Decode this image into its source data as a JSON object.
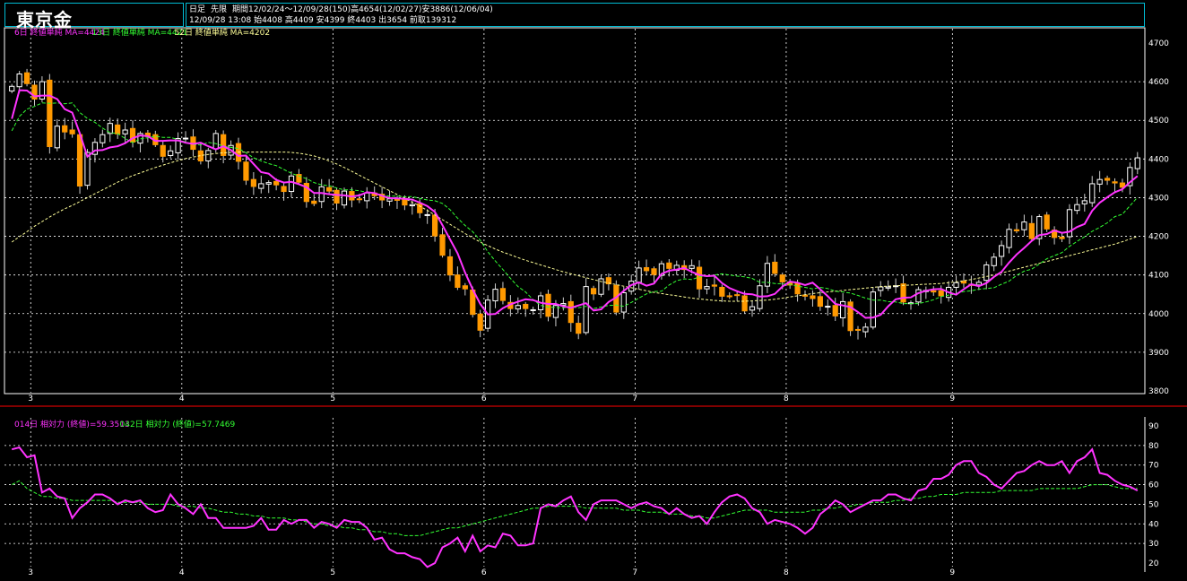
{
  "title": "東京金",
  "header": {
    "line1": {
      "chart_type": "日足",
      "contract": "先限",
      "period": "期間12/02/24～12/09/28(150)",
      "high": "高4654(12/02/27)",
      "low": "安3886(12/06/04)"
    },
    "line2": "12/09/28 13:08 始4408 高4409 安4399 終4403 出3654 前取139312"
  },
  "upper_legend": [
    {
      "text": "6日 終値単純 MA=4424",
      "color": "#ff33ff"
    },
    {
      "text": "13日 終値単純 MA=4421",
      "color": "#33ff33"
    },
    {
      "text": "52日 終値単純 MA=4202",
      "color": "#ffff99"
    }
  ],
  "lower_legend": [
    {
      "text": "014日 相対力 (終値)=59.3513",
      "color": "#ff33ff"
    },
    {
      "text": "042日 相対力 (終値)=57.7469",
      "color": "#33ff33"
    }
  ],
  "colors": {
    "up": "#ffffff",
    "down": "#ff9900",
    "ma6": "#ff33ff",
    "ma13": "#33ff33",
    "ma52": "#ffff99",
    "rsi14": "#ff33ff",
    "rsi42": "#33ff33",
    "frame": "#00bcd4",
    "separator": "#ff0000"
  },
  "chart_data": [
    {
      "type": "candlestick",
      "ylim": [
        3800,
        4700
      ],
      "y_ticks": [
        "4700",
        "4600",
        "4500",
        "4400",
        "4300",
        "4200",
        "4100",
        "4000",
        "3900",
        "3800"
      ],
      "x_month_labels": [
        "3",
        "4",
        "5",
        "6",
        "7",
        "8",
        "9"
      ],
      "x_month_positions": [
        2.5,
        22.5,
        42.5,
        62.5,
        82.5,
        102.5,
        124.5
      ],
      "n": 150,
      "closes": [
        4588,
        4620,
        4595,
        4555,
        4600,
        4432,
        4485,
        4470,
        4465,
        4330,
        4417,
        4443,
        4463,
        4492,
        4465,
        4475,
        4444,
        4466,
        4458,
        4437,
        4407,
        4421,
        4453,
        4454,
        4425,
        4395,
        4422,
        4466,
        4409,
        4435,
        4394,
        4345,
        4329,
        4336,
        4339,
        4333,
        4316,
        4356,
        4340,
        4290,
        4285,
        4328,
        4317,
        4286,
        4317,
        4294,
        4296,
        4312,
        4305,
        4294,
        4297,
        4293,
        4281,
        4282,
        4261,
        4256,
        4201,
        4151,
        4100,
        4068,
        4064,
        3998,
        3957,
        4035,
        4063,
        4034,
        4013,
        4021,
        4013,
        4010,
        4046,
        3993,
        4021,
        4026,
        3977,
        3949,
        4070,
        4051,
        4090,
        4077,
        4004,
        4054,
        4084,
        4118,
        4111,
        4101,
        4129,
        4117,
        4125,
        4114,
        4124,
        4064,
        4070,
        4071,
        4045,
        4044,
        4048,
        4007,
        4018,
        4072,
        4130,
        4104,
        4082,
        4074,
        4051,
        4045,
        4039,
        4019,
        4019,
        3994,
        4031,
        3956,
        3957,
        3965,
        4056,
        4069,
        4069,
        4072,
        4030,
        4028,
        4062,
        4060,
        4056,
        4046,
        4068,
        4080,
        4079,
        4073,
        4081,
        4126,
        4146,
        4176,
        4218,
        4214,
        4237,
        4194,
        4251,
        4219,
        4197,
        4194,
        4269,
        4282,
        4292,
        4336,
        4347,
        4345,
        4338,
        4327,
        4378,
        4403
      ],
      "ma6": [
        4504,
        4578,
        4577,
        4562,
        4564,
        4564,
        4555,
        4529,
        4520,
        4466,
        4406,
        4422,
        4423,
        4430,
        4433,
        4441,
        4454,
        4461,
        4459,
        4447,
        4447,
        4448,
        4448,
        4442,
        4439,
        4442,
        4433,
        4425,
        4433,
        4423,
        4408,
        4409,
        4387,
        4366,
        4362,
        4346,
        4339,
        4341,
        4335,
        4327,
        4312,
        4312,
        4309,
        4307,
        4306,
        4303,
        4306,
        4314,
        4312,
        4305,
        4299,
        4298,
        4297,
        4295,
        4287,
        4278,
        4263,
        4229,
        4192,
        4156,
        4106,
        4063,
        4025,
        3998,
        3999,
        4014,
        4024,
        4031,
        4037,
        4035,
        4028,
        4025,
        4025,
        4019,
        4015,
        4021,
        4027,
        4008,
        4011,
        4030,
        4042,
        4059,
        4074,
        4081,
        4072,
        4078,
        4103,
        4111,
        4114,
        4118,
        4108,
        4100,
        4097,
        4098,
        4079,
        4066,
        4058,
        4051,
        4050,
        4044,
        4045,
        4051,
        4070,
        4083,
        4080,
        4074,
        4080,
        4063,
        4045,
        4025,
        4021,
        4017,
        4004,
        3989,
        3990,
        3997,
        4019,
        4037,
        4041,
        4042,
        4053,
        4059,
        4063,
        4064,
        4055,
        4049,
        4063,
        4076,
        4071,
        4079,
        4095,
        4108,
        4132,
        4153,
        4170,
        4188,
        4203,
        4206,
        4215,
        4209,
        4212,
        4224,
        4232,
        4266,
        4287,
        4301,
        4314,
        4322,
        4340,
        4356
      ],
      "ma13": [
        4473,
        4510,
        4529,
        4536,
        4545,
        4544,
        4545,
        4543,
        4545,
        4520,
        4505,
        4495,
        4480,
        4468,
        4466,
        4453,
        4442,
        4452,
        4455,
        4459,
        4456,
        4456,
        4450,
        4444,
        4438,
        4436,
        4443,
        4440,
        4433,
        4430,
        4427,
        4416,
        4403,
        4395,
        4388,
        4383,
        4373,
        4363,
        4356,
        4349,
        4339,
        4333,
        4331,
        4325,
        4320,
        4320,
        4318,
        4314,
        4312,
        4306,
        4304,
        4304,
        4302,
        4303,
        4298,
        4294,
        4292,
        4285,
        4269,
        4247,
        4228,
        4212,
        4190,
        4160,
        4136,
        4114,
        4091,
        4070,
        4056,
        4036,
        4021,
        4017,
        4016,
        4015,
        4017,
        4015,
        4019,
        4013,
        4017,
        4021,
        4022,
        4019,
        4029,
        4040,
        4051,
        4057,
        4058,
        4074,
        4085,
        4090,
        4088,
        4095,
        4097,
        4100,
        4103,
        4100,
        4097,
        4095,
        4091,
        4081,
        4081,
        4078,
        4077,
        4076,
        4071,
        4068,
        4064,
        4068,
        4065,
        4058,
        4056,
        4053,
        4047,
        4040,
        4035,
        4035,
        4031,
        4030,
        4026,
        4026,
        4026,
        4030,
        4036,
        4044,
        4048,
        4052,
        4057,
        4059,
        4063,
        4065,
        4067,
        4076,
        4084,
        4099,
        4110,
        4115,
        4128,
        4142,
        4150,
        4158,
        4174,
        4187,
        4199,
        4213,
        4223,
        4235,
        4251,
        4257,
        4279,
        4301
      ],
      "ma52": [
        4185,
        4199,
        4212,
        4226,
        4238,
        4250,
        4261,
        4271,
        4280,
        4290,
        4300,
        4310,
        4320,
        4330,
        4340,
        4349,
        4357,
        4364,
        4371,
        4378,
        4384,
        4390,
        4396,
        4401,
        4405,
        4409,
        4412,
        4414,
        4416,
        4417,
        4418,
        4418,
        4418,
        4418,
        4418,
        4418,
        4418,
        4417,
        4415,
        4412,
        4408,
        4402,
        4395,
        4387,
        4378,
        4368,
        4358,
        4348,
        4338,
        4328,
        4318,
        4308,
        4298,
        4288,
        4278,
        4267,
        4255,
        4243,
        4231,
        4219,
        4207,
        4196,
        4185,
        4176,
        4167,
        4159,
        4152,
        4145,
        4138,
        4132,
        4126,
        4120,
        4114,
        4108,
        4103,
        4098,
        4093,
        4088,
        4083,
        4079,
        4075,
        4071,
        4067,
        4063,
        4059,
        4055,
        4052,
        4049,
        4046,
        4043,
        4040,
        4038,
        4036,
        4034,
        4033,
        4032,
        4032,
        4032,
        4033,
        4034,
        4035,
        4037,
        4040,
        4043,
        4046,
        4049,
        4052,
        4054,
        4056,
        4058,
        4060,
        4062,
        4064,
        4066,
        4068,
        4070,
        4071,
        4072,
        4073,
        4074,
        4075,
        4076,
        4077,
        4078,
        4080,
        4082,
        4085,
        4088,
        4092,
        4096,
        4100,
        4105,
        4110,
        4115,
        4120,
        4125,
        4130,
        4135,
        4140,
        4145,
        4150,
        4155,
        4160,
        4165,
        4170,
        4175,
        4180,
        4186,
        4193,
        4200
      ]
    },
    {
      "type": "line",
      "ylim": [
        20,
        90
      ],
      "y_ticks": [
        "90",
        "80",
        "70",
        "60",
        "50",
        "40",
        "30",
        "20"
      ],
      "rsi14": [
        78,
        79,
        74,
        75,
        56,
        58,
        54,
        53,
        43,
        48,
        51,
        55,
        55,
        53,
        50,
        52,
        51,
        52,
        48,
        46,
        47,
        55,
        50,
        48,
        45,
        50,
        43,
        43,
        38,
        38,
        38,
        38,
        39,
        43,
        37,
        37,
        42,
        40,
        42,
        42,
        38,
        41,
        40,
        38,
        42,
        41,
        41,
        38,
        32,
        33,
        27,
        25,
        25,
        23,
        22,
        18,
        20,
        28,
        30,
        33,
        26,
        34,
        26,
        29,
        28,
        35,
        34,
        29,
        29,
        30,
        48,
        50,
        49,
        52,
        54,
        46,
        42,
        50,
        52,
        52,
        52,
        50,
        48,
        50,
        51,
        49,
        48,
        45,
        48,
        45,
        43,
        44,
        40,
        46,
        51,
        54,
        55,
        53,
        48,
        46,
        40,
        42,
        41,
        40,
        38,
        35,
        38,
        45,
        48,
        52,
        50,
        46,
        48,
        50,
        52,
        52,
        55,
        55,
        53,
        52,
        57,
        58,
        63,
        63,
        65,
        70,
        72,
        72,
        66,
        64,
        60,
        58,
        62,
        66,
        67,
        70,
        72,
        70,
        70,
        72,
        66,
        72,
        74,
        78,
        66,
        65,
        62,
        60,
        59,
        57
      ],
      "rsi42": [
        60,
        62,
        58,
        56,
        54,
        54,
        53,
        53,
        52,
        52,
        52,
        52,
        52,
        52,
        51,
        51,
        51,
        51,
        50,
        50,
        50,
        50,
        49,
        49,
        49,
        48,
        48,
        47,
        46,
        46,
        45,
        45,
        44,
        44,
        43,
        43,
        43,
        42,
        42,
        41,
        40,
        40,
        39,
        39,
        38,
        38,
        37,
        37,
        36,
        36,
        35,
        35,
        34,
        34,
        34,
        35,
        36,
        37,
        38,
        38,
        39,
        40,
        41,
        42,
        43,
        44,
        45,
        46,
        47,
        48,
        48,
        49,
        49,
        49,
        49,
        49,
        48,
        48,
        48,
        48,
        48,
        47,
        47,
        47,
        46,
        46,
        46,
        45,
        45,
        45,
        44,
        44,
        43,
        43,
        44,
        45,
        46,
        47,
        47,
        47,
        47,
        46,
        46,
        46,
        46,
        46,
        47,
        47,
        48,
        48,
        49,
        49,
        50,
        50,
        51,
        51,
        51,
        52,
        52,
        53,
        53,
        54,
        54,
        55,
        55,
        55,
        56,
        56,
        56,
        56,
        56,
        57,
        57,
        57,
        57,
        57,
        58,
        58,
        58,
        58,
        58,
        58,
        59,
        60,
        60,
        60,
        59,
        58,
        58,
        58
      ]
    }
  ]
}
